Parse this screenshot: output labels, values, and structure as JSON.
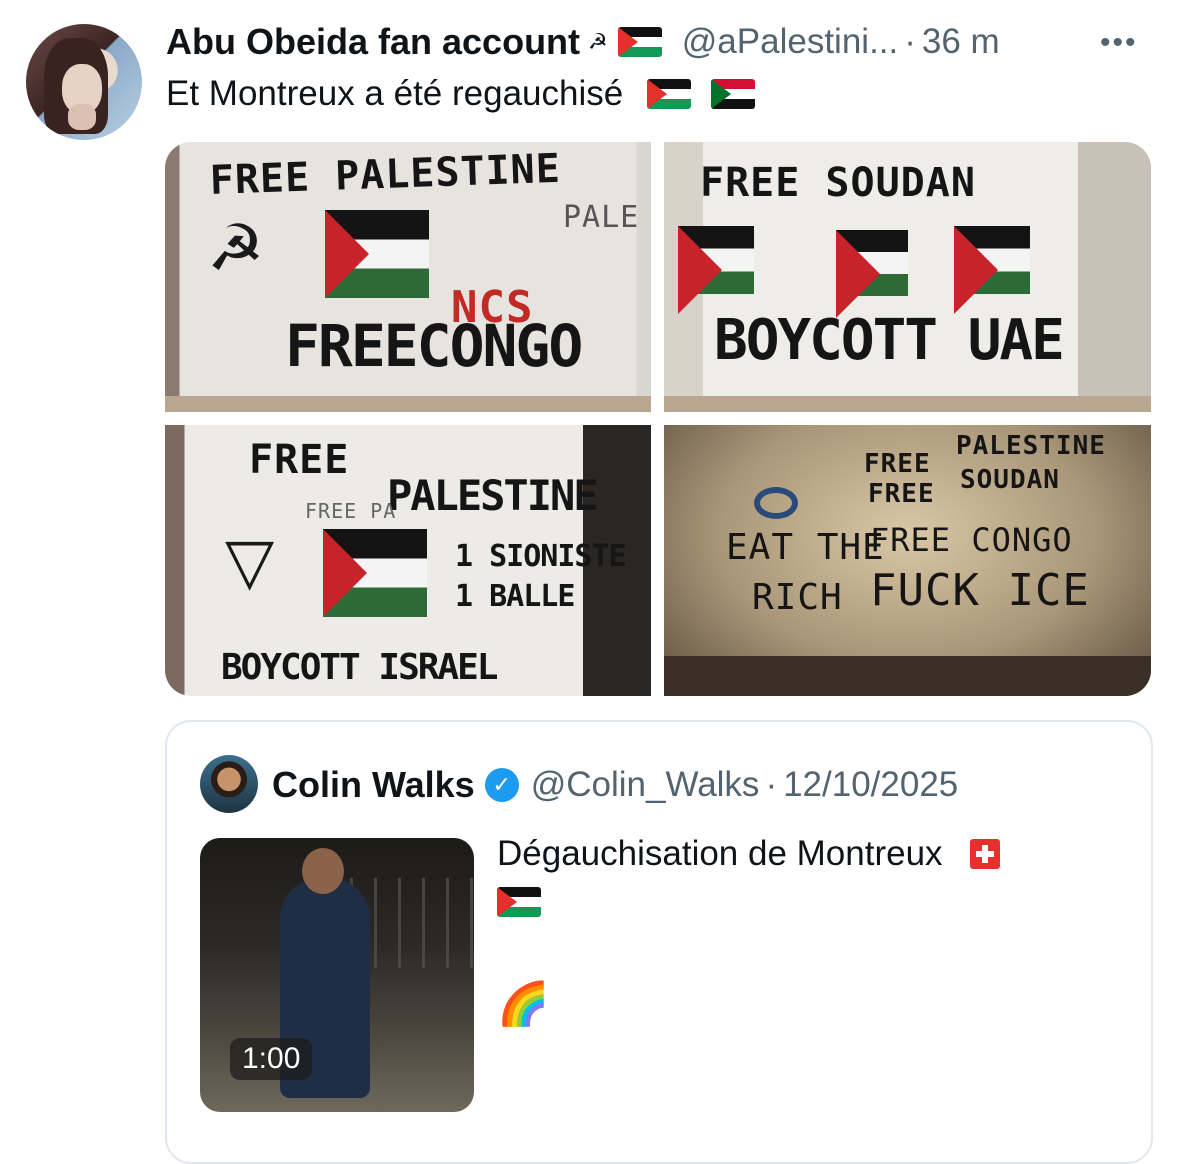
{
  "tweet": {
    "display_name": "Abu Obeida fan account",
    "name_icons": [
      "☭"
    ],
    "handle": "@aPalestini...",
    "separator": "·",
    "time": "36 m",
    "more": "•••",
    "text": "Et Montreux a été regauchisé"
  },
  "photos": [
    {
      "texts": [
        "FREE PALESTINE",
        "FREECONGO",
        "PALE",
        "NCS"
      ],
      "symbol": "☭"
    },
    {
      "texts": [
        "FREE SOUDAN",
        "BOYCOTT UAE"
      ]
    },
    {
      "texts": [
        "FREE",
        "PALESTINE",
        "1 SIONISTE",
        "1 BALLE",
        "BOYCOTT ISRAEL",
        "FREE PA"
      ],
      "symbol": "▽"
    },
    {
      "texts": [
        "EAT THE",
        "RICH",
        "FREE",
        "PALESTINE",
        "FREE",
        "SOUDAN",
        "FREE CONGO",
        "FUCK ICE"
      ]
    }
  ],
  "quoted": {
    "display_name": "Colin Walks",
    "verified_mark": "✓",
    "handle": "@Colin_Walks",
    "separator": "·",
    "date": "12/10/2025",
    "text": "Dégauchisation de Montreux",
    "emoji_rainbow": "🌈",
    "video_duration": "1:00"
  },
  "colors": {
    "text": "#0f1419",
    "secondary": "#536471",
    "border": "#e1e8ed",
    "verified": "#1d9bf0"
  }
}
